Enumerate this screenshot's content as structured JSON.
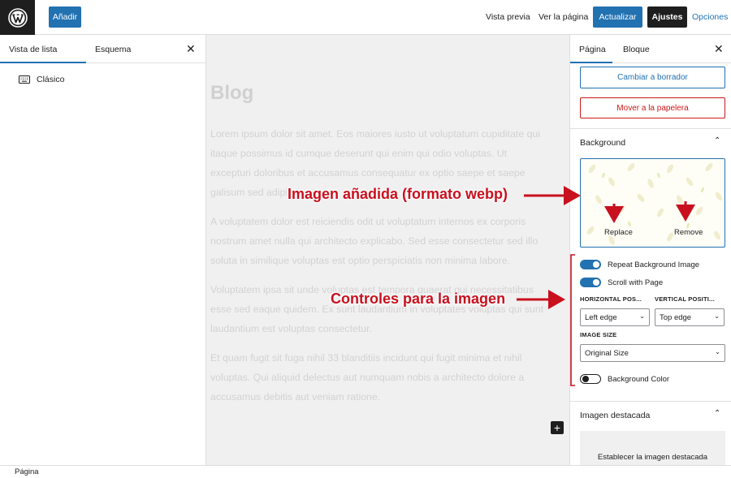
{
  "topbar": {
    "add_label": "Añadir",
    "preview_label": "Vista previa",
    "view_page_label": "Ver la página",
    "update_label": "Actualizar",
    "settings_label": "Ajustes",
    "options_label": "Opciones"
  },
  "left_panel": {
    "tabs": [
      {
        "label": "Vista de lista"
      },
      {
        "label": "Esquema"
      }
    ],
    "items": [
      {
        "label": "Clásico"
      }
    ]
  },
  "canvas": {
    "title": "Blog",
    "paragraphs": [
      [
        "Lorem ipsum dolor sit amet. Eos maiores iusto ut voluptatum cupiditate qui",
        "itaque possimus id cumque deserunt qui enim qui odio voluptas. Ut",
        "excepturi doloribus et accusamus consequatur ex optio saepe et saepe",
        "galisum sed adipisci."
      ],
      [
        "A voluptatem dolor est reiciendis odit ut voluptatum internos ex corporis",
        "nostrum amet nulla qui architecto explicabo. Sed esse consectetur sed illo",
        "soluta in similique voluptas est optio perspiciatis non minima labore."
      ],
      [
        "Voluptatem ipsa sit unde voluptas est tempora quaerat qui necessitatibus",
        "esse sed eaque quidem. Ex sunt laudantium in voluptates voluptas qui sunt",
        "laudantium est voluptas consectetur."
      ],
      [
        "Et quam fugit sit fuga nihil 33 blanditiis incidunt qui fugit minima et nihil",
        "voluptas. Qui aliquid delectus aut numquam nobis a architecto dolore a",
        "accusamus debitis aut veniam ratione."
      ]
    ]
  },
  "right_panel": {
    "tabs": [
      {
        "label": "Página"
      },
      {
        "label": "Bloque"
      }
    ],
    "draft_label": "Cambiar a borrador",
    "trash_label": "Mover a la papelera",
    "background": {
      "title": "Background",
      "replace_label": "Replace",
      "remove_label": "Remove",
      "repeat_label": "Repeat Background Image",
      "repeat_on": true,
      "scroll_label": "Scroll with Page",
      "scroll_on": true,
      "horizontal_label": "HORIZONTAL POS...",
      "vertical_label": "VERTICAL POSITI...",
      "horizontal_value": "Left edge",
      "vertical_value": "Top edge",
      "size_label": "IMAGE SIZE",
      "size_value": "Original Size",
      "color_label": "Background Color",
      "color_on": false
    },
    "featured": {
      "title": "Imagen destacada",
      "set_label": "Establecer la imagen destacada"
    }
  },
  "annotations": {
    "image_added": "Imagen añadida (formato webp)",
    "controls": "Controles para la imagen"
  },
  "bottombar": {
    "label": "Página"
  },
  "colors": {
    "accent": "#2271b1",
    "danger": "#cc1818",
    "annotation": "#c8101e",
    "dark": "#1e1e1e"
  }
}
